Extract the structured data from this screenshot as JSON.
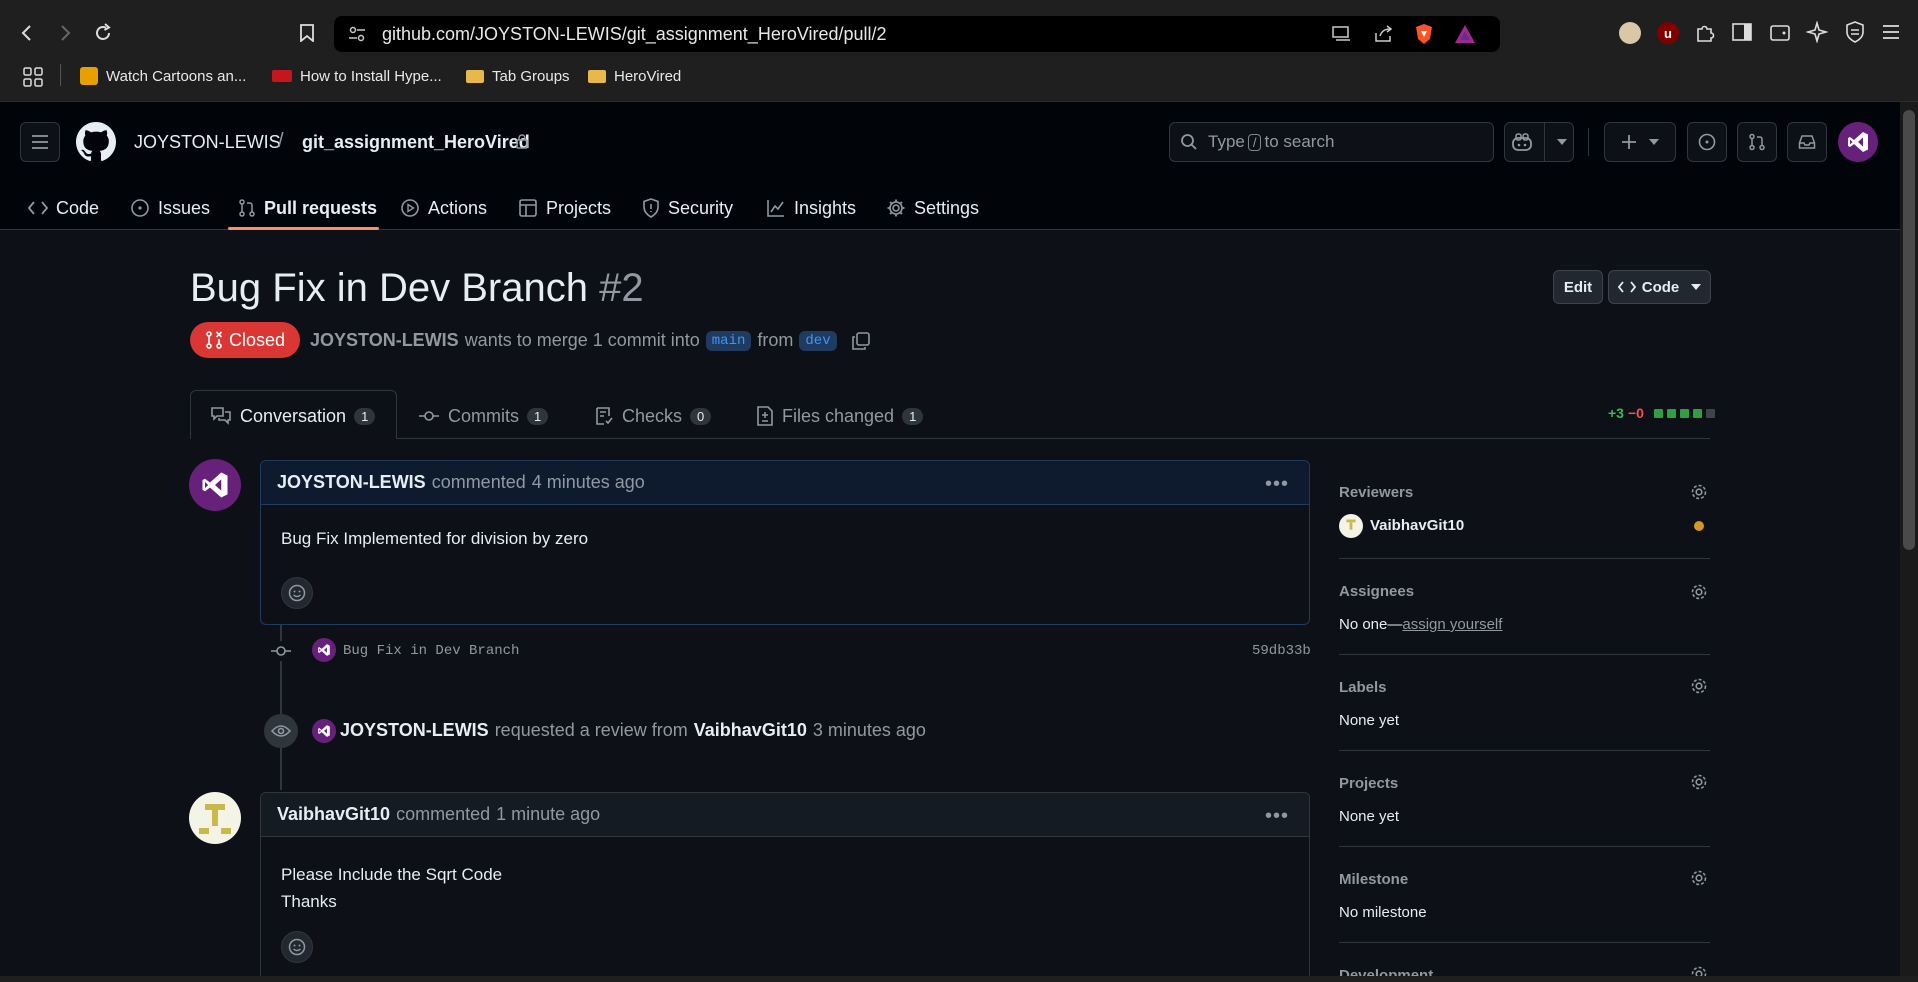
{
  "browser": {
    "url": "github.com/JOYSTON-LEWIS/git_assignment_HeroVired/pull/2",
    "bookmarks": [
      "Watch Cartoons an...",
      "How to Install Hype...",
      "Tab Groups",
      "HeroVired"
    ]
  },
  "header": {
    "owner": "JOYSTON-LEWIS",
    "separator": "/",
    "repo": "git_assignment_HeroVired",
    "search_pre": "Type",
    "search_key": "/",
    "search_post": "to search"
  },
  "repo_tabs": [
    {
      "label": "Code",
      "icon": "code-icon"
    },
    {
      "label": "Issues",
      "icon": "issue-icon"
    },
    {
      "label": "Pull requests",
      "icon": "pull-request-icon",
      "active": true
    },
    {
      "label": "Actions",
      "icon": "play-icon"
    },
    {
      "label": "Projects",
      "icon": "table-icon"
    },
    {
      "label": "Security",
      "icon": "shield-icon"
    },
    {
      "label": "Insights",
      "icon": "graph-icon"
    },
    {
      "label": "Settings",
      "icon": "gear-icon"
    }
  ],
  "pr": {
    "title": "Bug Fix in Dev Branch",
    "number": "#2",
    "state": "Closed",
    "author": "JOYSTON-LEWIS",
    "meta_mid": "wants to merge 1 commit into",
    "base": "main",
    "meta_from": "from",
    "head": "dev",
    "edit_label": "Edit",
    "code_label": "Code"
  },
  "pr_tabs": [
    {
      "label": "Conversation",
      "count": "1",
      "icon": "comment-discussion-icon"
    },
    {
      "label": "Commits",
      "count": "1",
      "icon": "commit-icon"
    },
    {
      "label": "Checks",
      "count": "0",
      "icon": "checklist-icon"
    },
    {
      "label": "Files changed",
      "count": "1",
      "icon": "file-diff-icon"
    }
  ],
  "diffstat": {
    "added": "+3",
    "removed": "−0",
    "colors": [
      "#2ea043",
      "#2ea043",
      "#2ea043",
      "#2ea043",
      "#3d444d"
    ]
  },
  "timeline": {
    "comment1": {
      "author": "JOYSTON-LEWIS",
      "action": "commented",
      "time": "4 minutes ago",
      "body": "Bug Fix Implemented for division by zero"
    },
    "commit": {
      "message": "Bug Fix in Dev Branch",
      "sha": "59db33b"
    },
    "review_request": {
      "actor": "JOYSTON-LEWIS",
      "action": "requested a review from",
      "reviewer": "VaibhavGit10",
      "time": "3 minutes ago"
    },
    "comment2": {
      "author": "VaibhavGit10",
      "action": "commented",
      "time": "1 minute ago",
      "body_line1": "Please Include the Sqrt Code",
      "body_line2": "Thanks"
    }
  },
  "sidebar": {
    "reviewers": {
      "title": "Reviewers",
      "name": "VaibhavGit10",
      "status_color": "#d29922"
    },
    "assignees": {
      "title": "Assignees",
      "value_prefix": "No one—",
      "link": "assign yourself"
    },
    "labels": {
      "title": "Labels",
      "value": "None yet"
    },
    "projects": {
      "title": "Projects",
      "value": "None yet"
    },
    "milestone": {
      "title": "Milestone",
      "value": "No milestone"
    },
    "development": {
      "title": "Development"
    }
  }
}
